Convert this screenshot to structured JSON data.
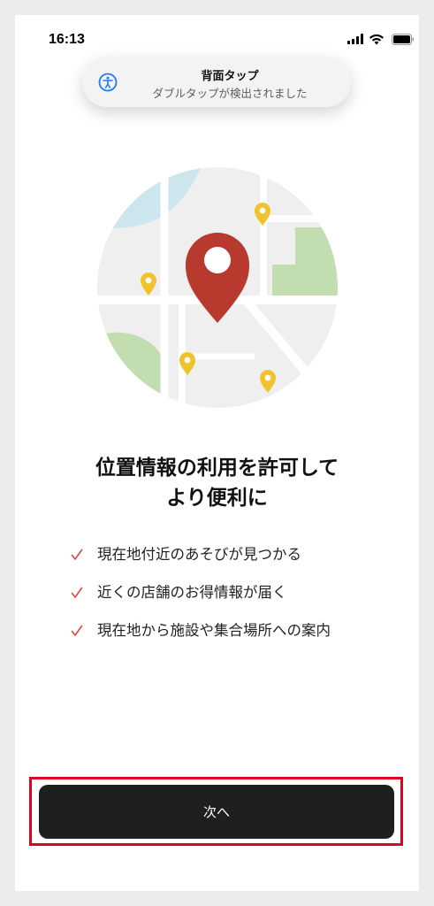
{
  "status_bar": {
    "time": "16:13",
    "icons": [
      "cellular-signal-icon",
      "wifi-icon",
      "battery-icon"
    ]
  },
  "toast": {
    "icon": "accessibility-icon",
    "title": "背面タップ",
    "subtitle": "ダブルタップが検出されました"
  },
  "illustration": {
    "icon": "map-pin-icon",
    "colors": {
      "map_bg": "#efefef",
      "water": "#cde6ee",
      "park": "#c2deb0",
      "main_pin": "#b83a2e",
      "small_pins": "#f2c12e"
    }
  },
  "headline": {
    "line1": "位置情報の利用を許可して",
    "line2": "より便利に"
  },
  "benefits": [
    "現在地付近のあそびが見つかる",
    "近くの店舗のお得情報が届く",
    "現在地から施設や集合場所への案内"
  ],
  "check_color": "#e6443a",
  "primary_button": {
    "label": "次へ"
  },
  "highlight_color": "#e0001b"
}
